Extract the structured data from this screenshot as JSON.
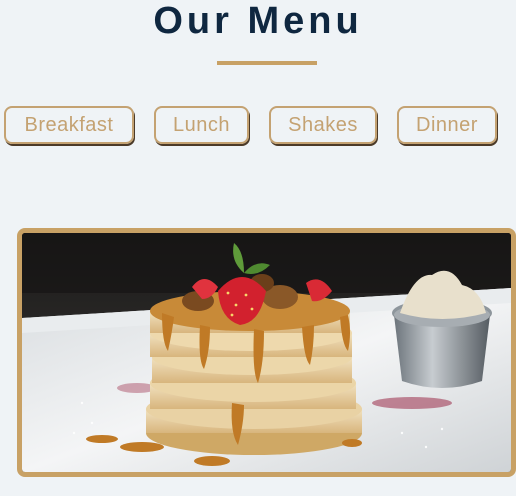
{
  "header": {
    "title": "Our Menu"
  },
  "tabs": [
    {
      "label": "Breakfast"
    },
    {
      "label": "Lunch"
    },
    {
      "label": "Shakes"
    },
    {
      "label": "Dinner"
    }
  ],
  "colors": {
    "accent": "#c8a165",
    "title": "#0f2740",
    "background": "#eff3f6"
  },
  "featured_image": {
    "subject": "pancake-stack"
  }
}
